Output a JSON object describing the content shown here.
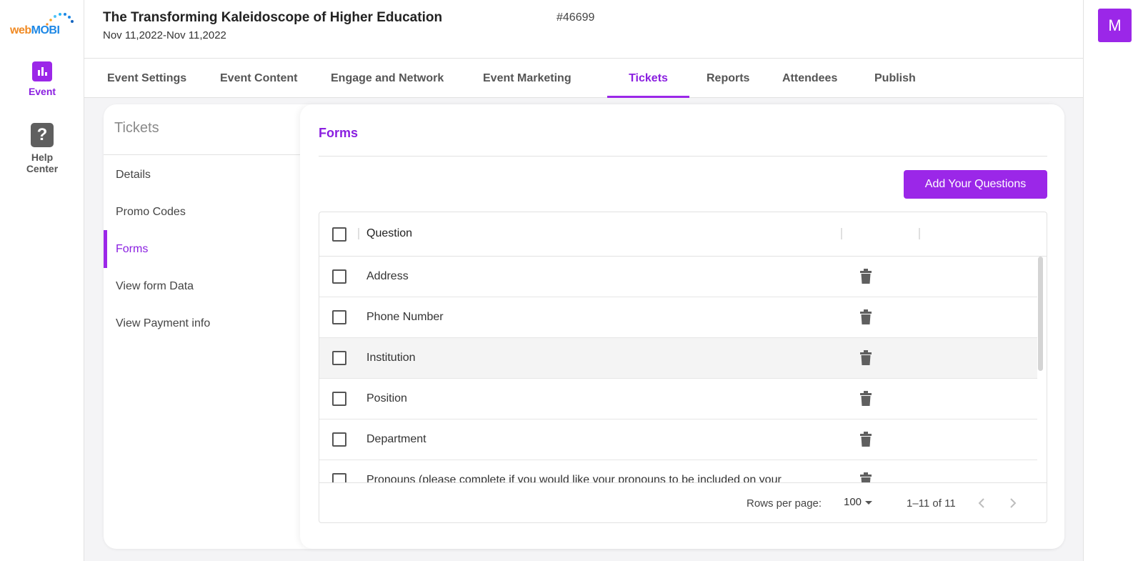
{
  "brand": {
    "logo_part1": "web",
    "logo_part2": "MOBI",
    "accent": "#9b27e8"
  },
  "rail": {
    "event_label": "Event",
    "help_label_1": "Help",
    "help_label_2": "Center"
  },
  "event": {
    "title": "The Transforming Kaleidoscope of Higher Education",
    "id": "#46699",
    "dates": "Nov 11,2022-Nov 11,2022"
  },
  "tabs": [
    {
      "label": "Event Settings"
    },
    {
      "label": "Event Content"
    },
    {
      "label": "Engage and Network"
    },
    {
      "label": "Event Marketing"
    },
    {
      "label": "Tickets",
      "active": true
    },
    {
      "label": "Reports"
    },
    {
      "label": "Attendees"
    },
    {
      "label": "Publish"
    }
  ],
  "user": {
    "initial": "M"
  },
  "subnav": {
    "title": "Tickets",
    "items": [
      {
        "label": "Details"
      },
      {
        "label": "Promo Codes"
      },
      {
        "label": "Forms",
        "active": true
      },
      {
        "label": "View form Data"
      },
      {
        "label": "View Payment info"
      }
    ]
  },
  "forms": {
    "title": "Forms",
    "add_button": "Add Your Questions",
    "column_question": "Question",
    "rows": [
      {
        "question": "Address"
      },
      {
        "question": "Phone Number"
      },
      {
        "question": "Institution"
      },
      {
        "question": "Position"
      },
      {
        "question": "Department"
      },
      {
        "question": "Pronouns (please complete if you would like your pronouns to be included on your"
      }
    ],
    "rows_per_page_label": "Rows per page:",
    "rows_per_page": "100",
    "range": "1–11 of 11"
  }
}
